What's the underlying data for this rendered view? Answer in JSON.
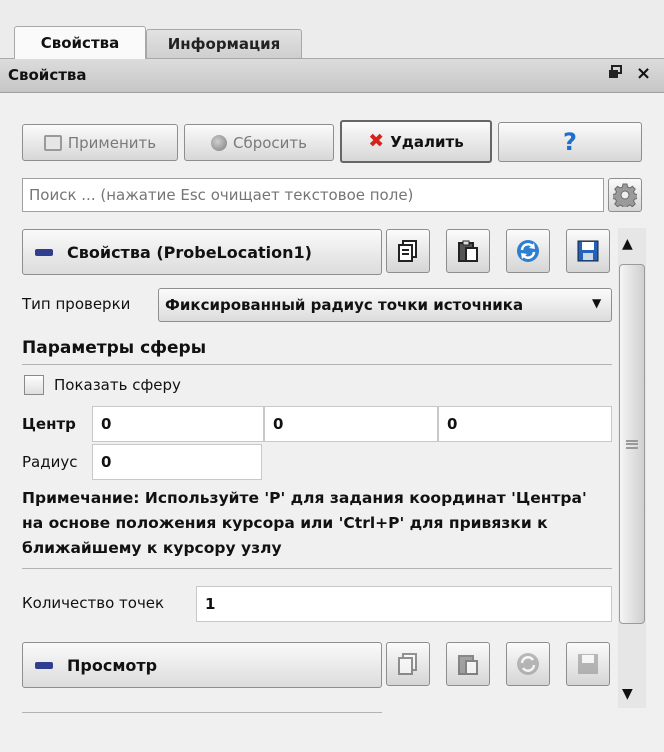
{
  "tabs": [
    {
      "label": "Свойства",
      "active": true
    },
    {
      "label": "Информация",
      "active": false
    }
  ],
  "dock": {
    "title": "Свойства",
    "float_symbol": "🗗",
    "close_symbol": "×"
  },
  "toolbar": {
    "apply_label": "Применить",
    "reset_label": "Сбросить",
    "delete_label": "Удалить",
    "help_label": "?"
  },
  "search": {
    "placeholder": "Поиск ... (нажатие Esc очищает текстовое поле)"
  },
  "properties_section": {
    "title": "Свойства (ProbeLocation1)"
  },
  "probe": {
    "type_label": "Тип проверки",
    "type_value": "Фиксированный радиус точки источника"
  },
  "sphere": {
    "group_title": "Параметры сферы",
    "show_sphere_label": "Показать сферу",
    "show_sphere_checked": false,
    "center_label": "Центр",
    "center": [
      "0",
      "0",
      "0"
    ],
    "radius_label": "Радиус",
    "radius": "0",
    "note": "Примечание: Используйте 'P' для задания координат 'Центра' на основе положения курсора или 'Ctrl+P' для привязки к ближайшему к курсору узлу"
  },
  "points": {
    "label": "Количество точек",
    "value": "1"
  },
  "view_section": {
    "title": "Просмотр"
  },
  "colors": {
    "accent": "#2f3e8e",
    "delete_red": "#d4231a",
    "help_blue": "#1d6fc9"
  }
}
